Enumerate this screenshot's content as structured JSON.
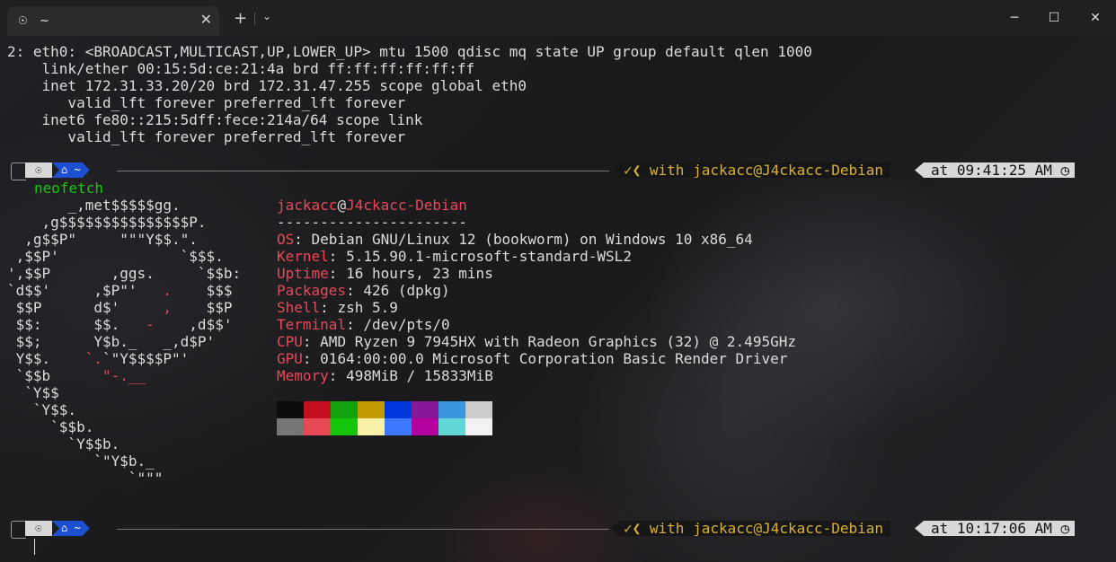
{
  "window": {
    "tab_icon": "☉",
    "tab_title": "~",
    "tab_close": "✕",
    "new_tab": "+",
    "dropdown": "⌄",
    "minimize": "─",
    "maximize": "☐",
    "close": "✕"
  },
  "ip_output": [
    "2: eth0: <BROADCAST,MULTICAST,UP,LOWER_UP> mtu 1500 qdisc mq state UP group default qlen 1000",
    "    link/ether 00:15:5d:ce:21:4a brd ff:ff:ff:ff:ff:ff",
    "    inet 172.31.33.20/20 brd 172.31.47.255 scope global eth0",
    "       valid_lft forever preferred_lft forever",
    "    inet6 fe80::215:5dff:fece:214a/64 scope link",
    "       valid_lft forever preferred_lft forever"
  ],
  "prompt1": {
    "os_icon": "☉",
    "dir": "⌂ ~",
    "status": "✓❮ with jackacc@J4ckacc-Debian",
    "time": "at 09:41:25 AM ◷",
    "command": "neofetch"
  },
  "prompt2": {
    "os_icon": "☉",
    "dir": "⌂ ~",
    "status": "✓❮ with jackacc@J4ckacc-Debian",
    "time": "at 10:17:06 AM ◷"
  },
  "logo": [
    [
      {
        "t": "       _,met$$$$$gg.",
        "c": "white"
      }
    ],
    [
      {
        "t": "    ,g$$$$$$$$$$$$$$$P.",
        "c": "white"
      }
    ],
    [
      {
        "t": "  ,g$$P\"     \"\"\"Y$$.\".",
        "c": "white"
      }
    ],
    [
      {
        "t": " ,$$P'              `$$$.",
        "c": "white"
      }
    ],
    [
      {
        "t": "',$$P       ,ggs.     `$$b:",
        "c": "white"
      }
    ],
    [
      {
        "t": "`d$$'     ,$P\"'   ",
        "c": "white"
      },
      {
        "t": ".",
        "c": "red"
      },
      {
        "t": "    $$$",
        "c": "white"
      }
    ],
    [
      {
        "t": " $$P      d$'     ",
        "c": "white"
      },
      {
        "t": ",",
        "c": "red"
      },
      {
        "t": "    $$P",
        "c": "white"
      }
    ],
    [
      {
        "t": " $$:      $$.   ",
        "c": "white"
      },
      {
        "t": "-",
        "c": "red"
      },
      {
        "t": "    ,d$$'",
        "c": "white"
      }
    ],
    [
      {
        "t": " $$;      Y$b._   _,d$P'",
        "c": "white"
      }
    ],
    [
      {
        "t": " Y$$.    ",
        "c": "white"
      },
      {
        "t": "`.",
        "c": "red"
      },
      {
        "t": "`\"Y$$$$P\"'",
        "c": "white"
      }
    ],
    [
      {
        "t": " `$$b      ",
        "c": "white"
      },
      {
        "t": "\"-.__",
        "c": "red"
      }
    ],
    [
      {
        "t": "  `Y$$",
        "c": "white"
      }
    ],
    [
      {
        "t": "   `Y$$.",
        "c": "white"
      }
    ],
    [
      {
        "t": "     `$$b.",
        "c": "white"
      }
    ],
    [
      {
        "t": "       `Y$$b.",
        "c": "white"
      }
    ],
    [
      {
        "t": "          `\"Y$b._",
        "c": "white"
      }
    ],
    [
      {
        "t": "              `\"\"\"",
        "c": "white"
      }
    ]
  ],
  "sysinfo": {
    "user": "jackacc",
    "at": "@",
    "host": "J4ckacc-Debian",
    "separator": "----------------------",
    "rows": [
      {
        "key": "OS",
        "value": ": Debian GNU/Linux 12 (bookworm) on Windows 10 x86_64"
      },
      {
        "key": "Kernel",
        "value": ": 5.15.90.1-microsoft-standard-WSL2"
      },
      {
        "key": "Uptime",
        "value": ": 16 hours, 23 mins"
      },
      {
        "key": "Packages",
        "value": ": 426 (dpkg)"
      },
      {
        "key": "Shell",
        "value": ": zsh 5.9"
      },
      {
        "key": "Terminal",
        "value": ": /dev/pts/0"
      },
      {
        "key": "CPU",
        "value": ": AMD Ryzen 9 7945HX with Radeon Graphics (32) @ 2.495GHz"
      },
      {
        "key": "GPU",
        "value": ": 0164:00:00.0 Microsoft Corporation Basic Render Driver"
      },
      {
        "key": "Memory",
        "value": ": 498MiB / 15833MiB"
      }
    ]
  },
  "palette": {
    "row1": [
      "#0c0c0c",
      "#c50f1f",
      "#13a10e",
      "#c19c00",
      "#0037da",
      "#881798",
      "#3a96dd",
      "#cccccc"
    ],
    "row2": [
      "#767676",
      "#e74856",
      "#16c60c",
      "#f9f1a5",
      "#3b78ff",
      "#b4009e",
      "#61d6d6",
      "#f2f2f2"
    ]
  },
  "colors": {
    "accent_red": "#e74856",
    "prompt_blue": "#1d4fd1",
    "prompt_gold": "#d9b036",
    "command_green": "#16c60c"
  }
}
